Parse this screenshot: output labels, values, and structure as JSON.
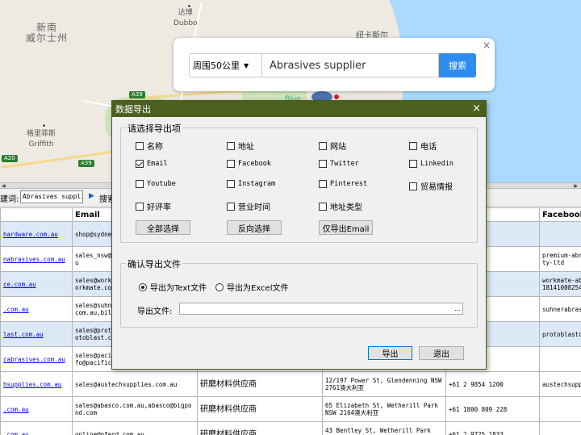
{
  "map": {
    "labels": {
      "nsw": "新南\n威尔士州",
      "dubbo": "达博\nDubbo",
      "griffith": "格里菲斯\nGriffith",
      "partial_city": "纽卡斯尔",
      "blue": "Blue"
    },
    "shields": [
      "A39",
      "A39",
      "A20"
    ]
  },
  "search": {
    "close": "×",
    "radius": "周围50公里",
    "query": "Abrasives supplier",
    "button": "搜索"
  },
  "toolbar": {
    "keyword_label": "建词:",
    "keyword_value": "Abrasives suppli",
    "search_label": "搜索"
  },
  "grid": {
    "headers": [
      "",
      "Email",
      "",
      "",
      "",
      "Facebook"
    ],
    "rows": [
      {
        "url": "hardware.com.au",
        "email": "shop@sydne",
        "category": "",
        "address": "",
        "phone": "7661",
        "facebook": ""
      },
      {
        "url": "nabrasives.com.au",
        "email": "sales_nsw@\nu",
        "category": "",
        "address": "",
        "phone": "1766",
        "facebook": "premium-abr\nty-ltd"
      },
      {
        "url": "ce.com.au",
        "email": "sales@work\norkmate.co",
        "category": "",
        "address": "",
        "phone": "1111",
        "facebook": "workmate-ab\n18141008254"
      },
      {
        "url": ".com.au",
        "email": "sales@suhn\ncom.au,bil",
        "category": "",
        "address": "",
        "phone": "5888",
        "facebook": "suhnerabras"
      },
      {
        "url": "last.com.au",
        "email": "sales@prot\notoblast.c",
        "category": "",
        "address": "",
        "phone": "2320",
        "facebook": "protoblastc"
      },
      {
        "url": "cabrasives.com.au",
        "email": "sales@paci\nfo@pacific",
        "category": "",
        "address": "",
        "phone": "1737",
        "facebook": ""
      },
      {
        "url": "hsupplies.com.au",
        "email": "sales@austechsupplies.com.au",
        "category": "研磨材料供应商",
        "address": "12/197 Power St, Glendenning NSW\n2761澳大利亚",
        "phone": "+61 2 9854 1200",
        "facebook": "austechsupp"
      },
      {
        "url": ".com.au",
        "email": "sales@abasco.com.au,abasco@bigpo\nnd.com",
        "category": "研磨材料供应商",
        "address": "65 Elizabeth St, Wetherill Park\nNSW 2164澳大利亚",
        "phone": "+61 1800 809 228",
        "facebook": ""
      },
      {
        "url": ".com.au",
        "email": "online@pferd.com.au",
        "category": "研磨材料供应商",
        "address": "43 Bentley St, Wetherill Park\nNSW 2164澳大利亚",
        "phone": "+61 2 9725 1833",
        "facebook": ""
      }
    ]
  },
  "dialog": {
    "title": "数据导出",
    "close": "×",
    "select_group_title": "请选择导出项",
    "fields": [
      {
        "label": "名称",
        "checked": false
      },
      {
        "label": "地址",
        "checked": false
      },
      {
        "label": "网站",
        "checked": false
      },
      {
        "label": "电话",
        "checked": false
      },
      {
        "label": "Email",
        "checked": true
      },
      {
        "label": "Facebook",
        "checked": false
      },
      {
        "label": "Twitter",
        "checked": false
      },
      {
        "label": "Linkedin",
        "checked": false
      },
      {
        "label": "Youtube",
        "checked": false
      },
      {
        "label": "Instagram",
        "checked": false
      },
      {
        "label": "Pinterest",
        "checked": false
      },
      {
        "label": "贸易情报",
        "checked": false
      },
      {
        "label": "好评率",
        "checked": false
      },
      {
        "label": "营业时间",
        "checked": false
      },
      {
        "label": "地址类型",
        "checked": false
      }
    ],
    "select_all": "全部选择",
    "invert_selection": "反向选择",
    "export_email_only": "仅导出Email",
    "export_group_title": "确认导出文件",
    "formats": [
      {
        "label": "导出为Text文件",
        "selected": true
      },
      {
        "label": "导出为Excel文件",
        "selected": false
      }
    ],
    "file_label": "导出文件:",
    "file_value": "",
    "browse": "...",
    "export_button": "导出",
    "exit_button": "退出"
  }
}
